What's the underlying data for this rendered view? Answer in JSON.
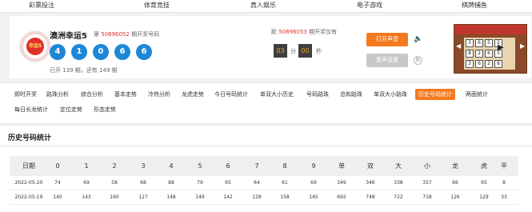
{
  "topnav": [
    "彩票投注",
    "体育竞技",
    "真人娱乐",
    "电子游戏",
    "棋牌捕鱼"
  ],
  "lottery": {
    "logo_text": "幸运5",
    "name": "澳洲幸运5",
    "issue_prefix": "第",
    "issue": "50896052",
    "issue_suffix": "期开奖号码",
    "balls": [
      "4",
      "1",
      "0",
      "6",
      "6"
    ],
    "count_text": "已开 139 期，还有 149 期",
    "next_prefix": "距",
    "next_issue": "50896053",
    "next_suffix": "期开奖仅有",
    "minutes": "03",
    "min_unit": "分",
    "seconds": "00",
    "sec_unit": "秒",
    "btn_sound": "打开声音",
    "btn_settings": "音声设置",
    "mute_label": "默",
    "game_cells": [
      "3",
      "6",
      "5",
      "2",
      "8",
      "2",
      "6",
      "5",
      "3",
      "6",
      "2",
      "8"
    ]
  },
  "tabs": [
    {
      "label": "即时开奖",
      "active": false
    },
    {
      "label": "路珠分析",
      "active": false
    },
    {
      "label": "综合分析",
      "active": false
    },
    {
      "label": "基本走势",
      "active": false
    },
    {
      "label": "冷热分析",
      "active": false
    },
    {
      "label": "龙虎走势",
      "active": false
    },
    {
      "label": "今日号码统计",
      "active": false
    },
    {
      "label": "单双大小历史",
      "active": false
    },
    {
      "label": "号码路珠",
      "active": false
    },
    {
      "label": "总和路珠",
      "active": false
    },
    {
      "label": "单双大小路珠",
      "active": false
    },
    {
      "label": "历史号码统计",
      "active": true
    },
    {
      "label": "两面统计",
      "active": false
    },
    {
      "label": "每日长龙统计",
      "active": false
    },
    {
      "label": "定位走势",
      "active": false
    },
    {
      "label": "形态走势",
      "active": false
    }
  ],
  "section": {
    "title": "历史号码统计",
    "headers": [
      "日期",
      "0",
      "1",
      "2",
      "3",
      "4",
      "5",
      "6",
      "7",
      "8",
      "9",
      "单",
      "双",
      "大",
      "小",
      "龙",
      "虎",
      "平"
    ],
    "rows": [
      [
        "2022-05-20",
        "74",
        "69",
        "58",
        "68",
        "88",
        "79",
        "65",
        "64",
        "61",
        "69",
        "349",
        "346",
        "338",
        "357",
        "66",
        "65",
        "8"
      ],
      [
        "2022-05-19",
        "140",
        "143",
        "160",
        "127",
        "148",
        "149",
        "142",
        "128",
        "158",
        "145",
        "692",
        "748",
        "722",
        "718",
        "126",
        "129",
        "33"
      ]
    ]
  },
  "colors": {
    "accent": "#f57a1f",
    "ball": "#1f87d6",
    "issue_red": "#e0302a"
  }
}
